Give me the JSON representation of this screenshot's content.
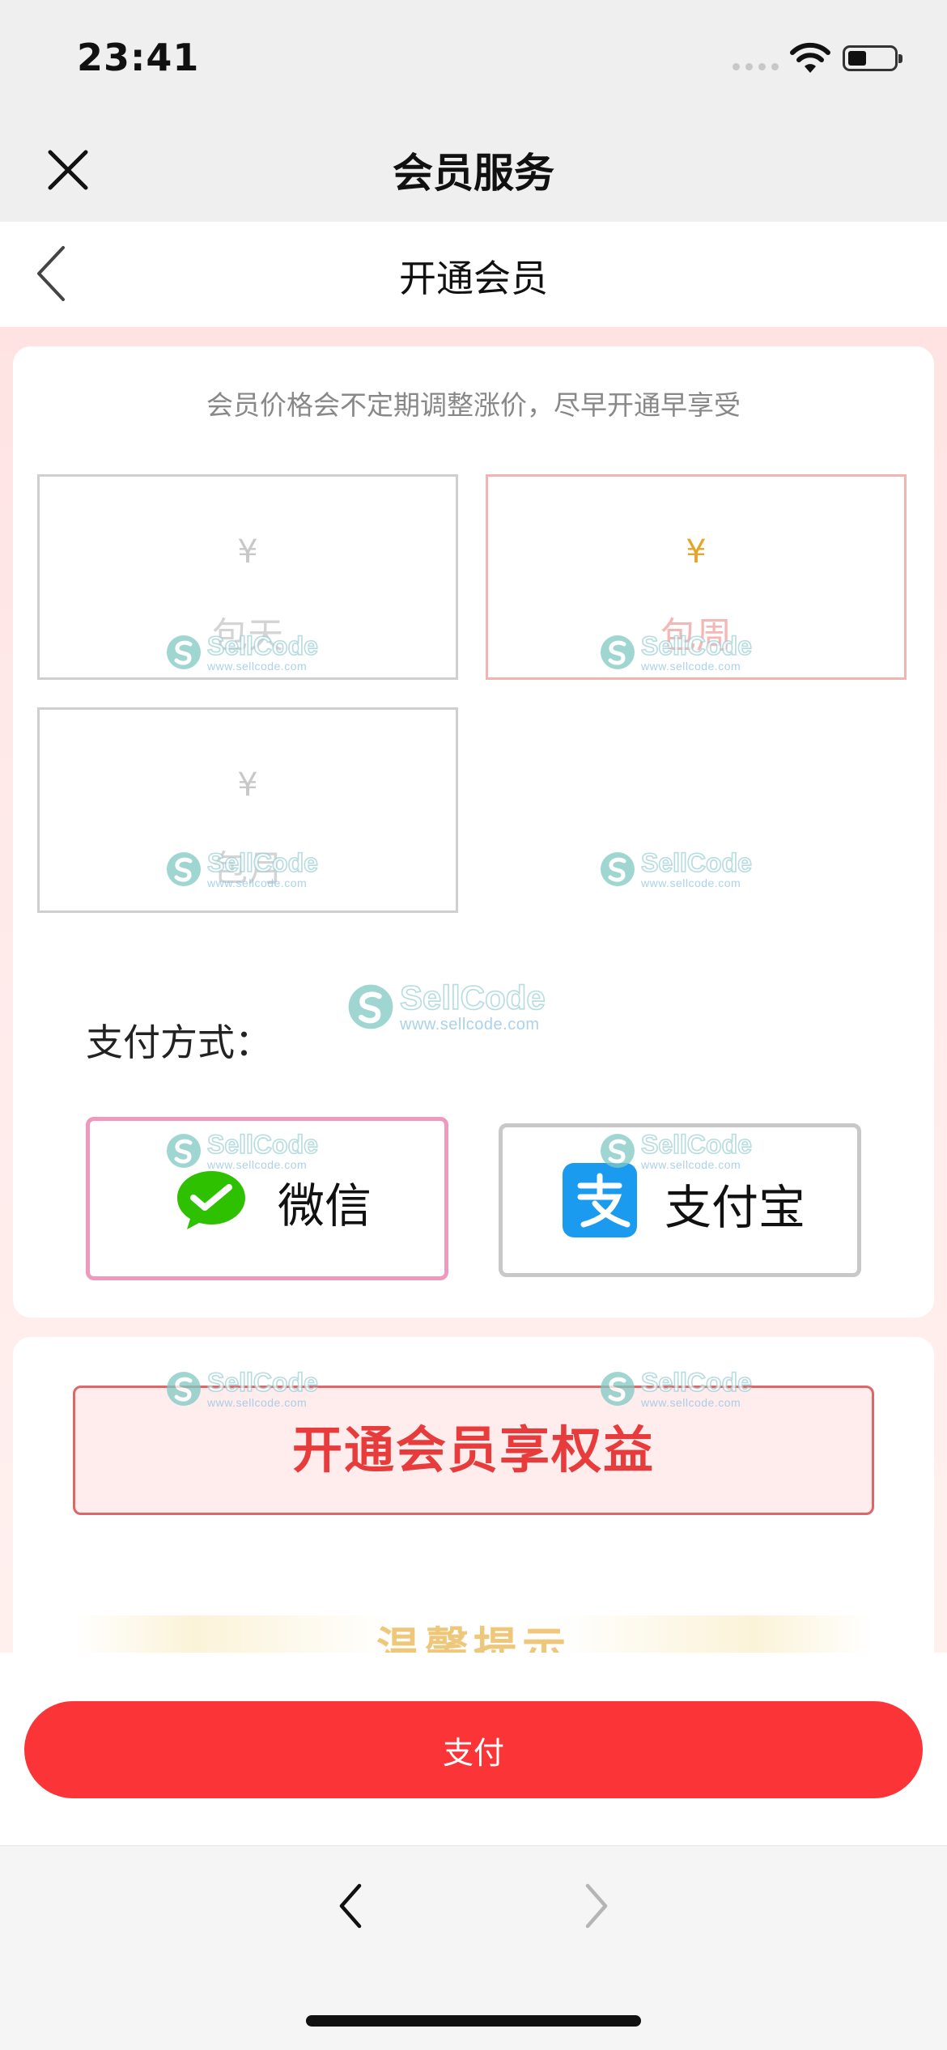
{
  "status_bar": {
    "time": "23:41"
  },
  "header": {
    "title": "会员服务",
    "close_icon": "close-icon"
  },
  "page": {
    "title": "开通会员",
    "back_icon": "chevron-left-icon"
  },
  "notice": "会员价格会不定期调整涨价，尽早开通早享受",
  "plans": [
    {
      "currency": "¥",
      "name": "包天",
      "selected": false
    },
    {
      "currency": "¥",
      "name": "包周",
      "selected": true
    },
    {
      "currency": "¥",
      "name": "包月",
      "selected": false
    }
  ],
  "payment": {
    "label": "支付方式：",
    "options": [
      {
        "name": "微信",
        "icon": "wechat-icon",
        "selected": true
      },
      {
        "name": "支付宝",
        "icon": "alipay-icon",
        "selected": false
      }
    ]
  },
  "benefits": {
    "button_label": "开通会员享权益",
    "tips_title": "温馨提示"
  },
  "pay_button_label": "支付",
  "watermark": {
    "brand": "SellCode",
    "url": "www.sellcode.com"
  },
  "colors": {
    "accent": "#fb3537",
    "selected_border": "#ee9abf",
    "price": "#e6a42a",
    "wechat": "#2dc100",
    "alipay": "#1a9bf0"
  }
}
